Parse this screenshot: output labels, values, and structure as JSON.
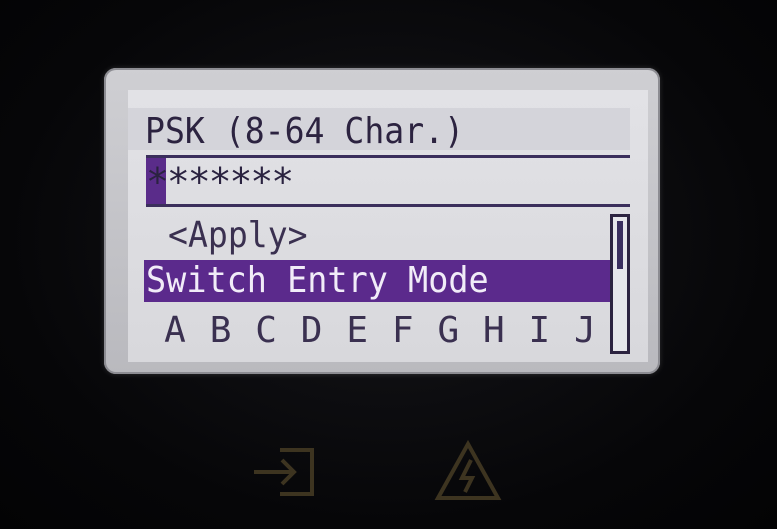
{
  "screen": {
    "title": "PSK (8-64 Char.)",
    "input_value": "*******",
    "menu_items": [
      {
        "label": "<Apply>",
        "selected": false
      },
      {
        "label": "Switch Entry Mode",
        "selected": true
      }
    ],
    "character_row": [
      "A",
      "B",
      "C",
      "D",
      "E",
      "F",
      "G",
      "H",
      "I",
      "J"
    ]
  },
  "hardware_icons": {
    "left": "login-arrow-icon",
    "right": "warning-lightning-icon",
    "color": "#3d3420"
  },
  "colors": {
    "lcd_background": "#dcdce0",
    "selection": "#5b2a8c",
    "text": "#2c2340"
  }
}
